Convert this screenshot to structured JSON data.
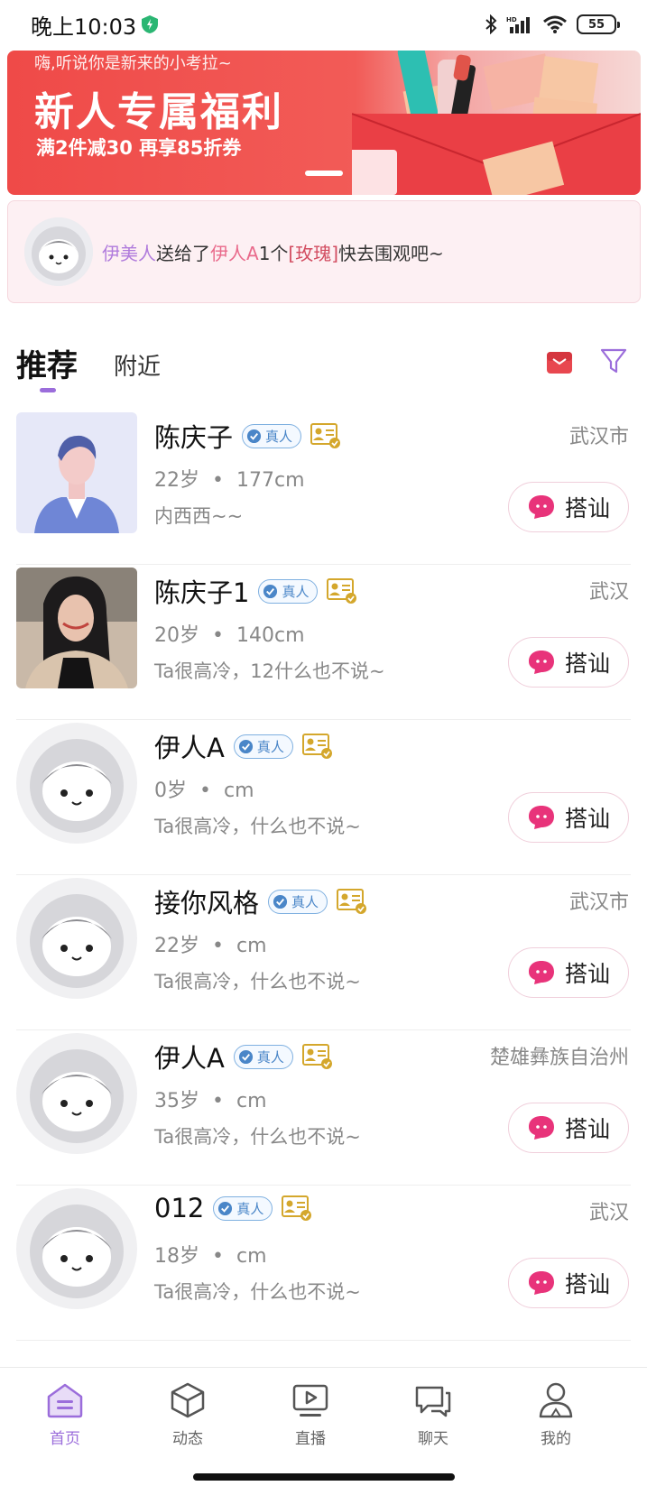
{
  "status_bar": {
    "time": "晚上10:03",
    "battery": "55"
  },
  "banner": {
    "greeting": "嗨,听说你是新来的小考拉~",
    "title": "新人专属福利",
    "subtitle": "满2件减30 再享85折券"
  },
  "notice": {
    "sender": "伊美人",
    "verb": "送给了",
    "receiver": "伊人A",
    "count": "1个",
    "gift": "[玫瑰]",
    "suffix": "快去围观吧~"
  },
  "tabs": [
    {
      "label": "推荐",
      "active": true
    },
    {
      "label": "附近",
      "active": false
    }
  ],
  "users": [
    {
      "name": "陈庆子",
      "badge": "真人",
      "city": "武汉市",
      "age": "22岁",
      "height": "177cm",
      "bio": "内西西~~",
      "action": "搭讪",
      "avatar": "man-illustration"
    },
    {
      "name": "陈庆子1",
      "badge": "真人",
      "city": "武汉",
      "age": "20岁",
      "height": "140cm",
      "bio": "Ta很高冷，12什么也不说~",
      "action": "搭讪",
      "avatar": "woman-photo"
    },
    {
      "name": "伊人A",
      "badge": "真人",
      "city": "",
      "age": "0岁",
      "height": "cm",
      "bio": "Ta很高冷，什么也不说~",
      "action": "搭讪",
      "avatar": "default-astronaut"
    },
    {
      "name": "接你风格",
      "badge": "真人",
      "city": "武汉市",
      "age": "22岁",
      "height": "cm",
      "bio": "Ta很高冷，什么也不说~",
      "action": "搭讪",
      "avatar": "default-astronaut"
    },
    {
      "name": "伊人A",
      "badge": "真人",
      "city": "楚雄彝族自治州",
      "age": "35岁",
      "height": "cm",
      "bio": "Ta很高冷，什么也不说~",
      "action": "搭讪",
      "avatar": "default-astronaut"
    },
    {
      "name": "012",
      "badge": "真人",
      "city": "武汉",
      "age": "18岁",
      "height": "cm",
      "bio": "Ta很高冷，什么也不说~",
      "action": "搭讪",
      "avatar": "default-astronaut"
    }
  ],
  "bottom_nav": [
    {
      "label": "首页",
      "icon": "home-icon",
      "active": true
    },
    {
      "label": "动态",
      "icon": "cube-icon",
      "active": false
    },
    {
      "label": "直播",
      "icon": "live-tv-icon",
      "active": false
    },
    {
      "label": "聊天",
      "icon": "chat-icon",
      "active": false
    },
    {
      "label": "我的",
      "icon": "profile-icon",
      "active": false
    }
  ],
  "colors": {
    "accent": "#9b6ddb",
    "banner_red": "#ef4a48",
    "gift_red": "#e8474f",
    "chat_pink": "#e8337a"
  }
}
